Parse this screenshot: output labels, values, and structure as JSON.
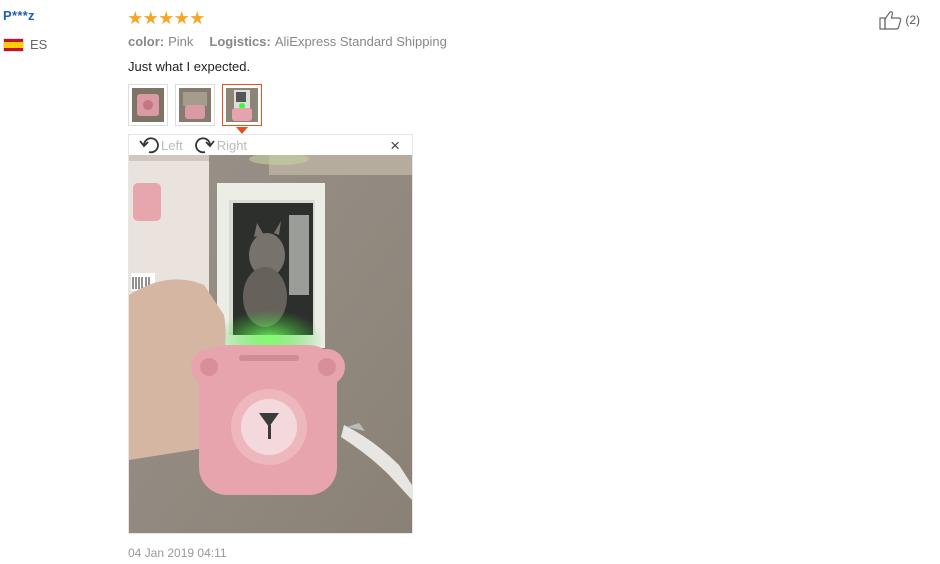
{
  "user": {
    "name": "P***z",
    "country": "ES",
    "flag_icon": "spain-flag-icon"
  },
  "review": {
    "rating": 5,
    "attributes": [
      {
        "label": "color:",
        "value": "Pink"
      },
      {
        "label": "Logistics:",
        "value": "AliExpress Standard Shipping"
      }
    ],
    "text": "Just what I expected.",
    "date": "04 Jan 2019 04:11"
  },
  "photos": {
    "count": 3,
    "active_index": 2
  },
  "viewer": {
    "rotate_left_label": "Left",
    "rotate_right_label": "Right",
    "close_label": "×"
  },
  "helpful": {
    "count_label": "(2)"
  },
  "colors": {
    "star": "#f5a623",
    "accent": "#e5511d",
    "username": "#1f5fb4"
  }
}
